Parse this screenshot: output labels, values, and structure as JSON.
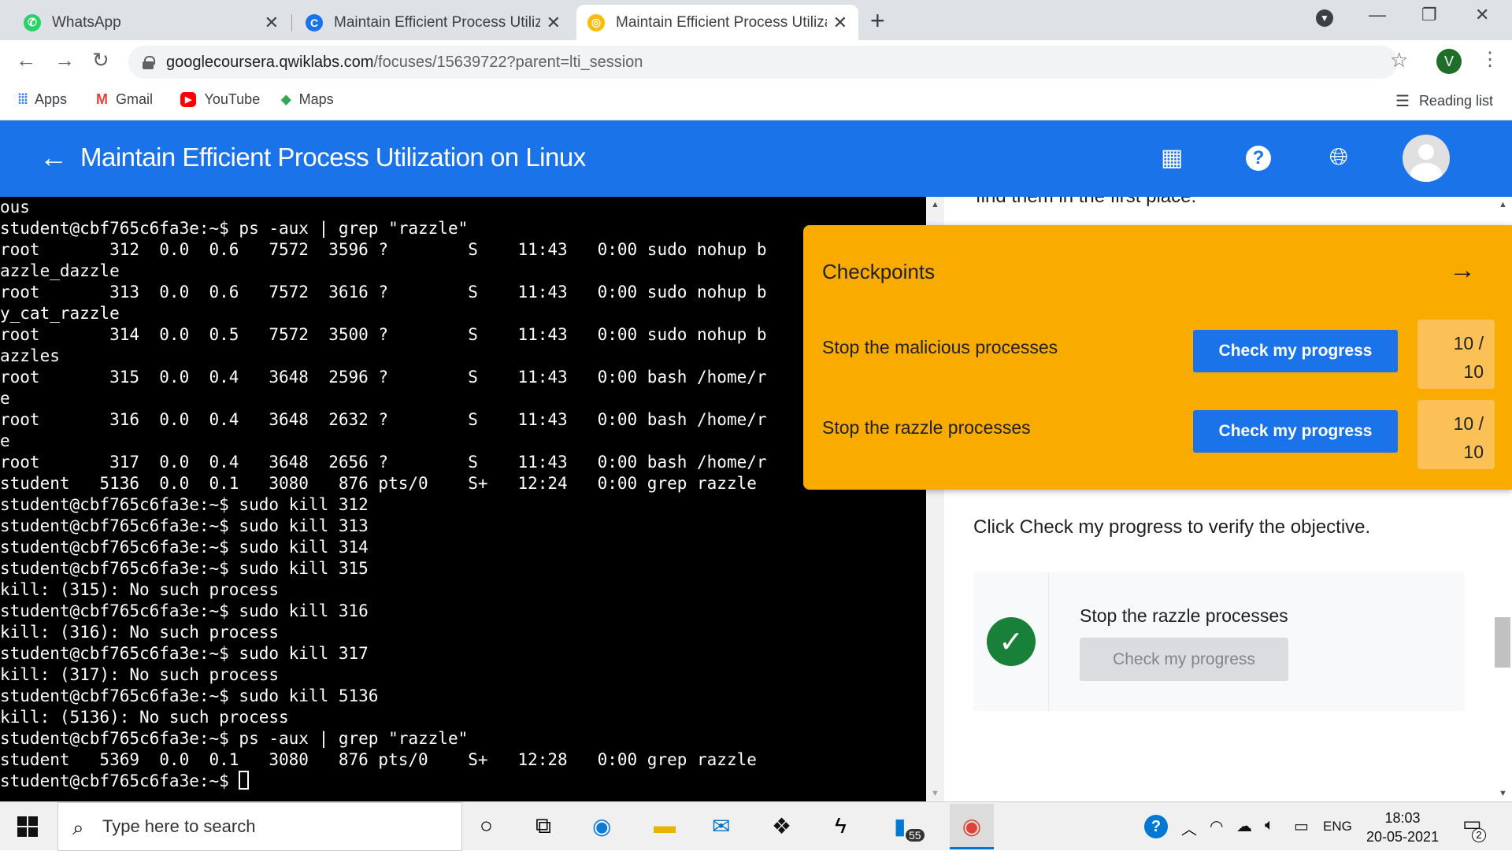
{
  "browser": {
    "tabs": [
      {
        "title": "WhatsApp",
        "favicon_color": "#25d366"
      },
      {
        "title": "Maintain Efficient Process Utilizat",
        "favicon_color": "#1a73e8"
      },
      {
        "title": "Maintain Efficient Process Utilizat",
        "favicon_color": "#fbbc04",
        "active": true
      }
    ],
    "new_tab_icon": "plus-icon",
    "url_host": "googlecoursera.qwiklabs.com",
    "url_path": "/focuses/15639722?parent=lti_session",
    "profile_initial": "V",
    "bookmarks": [
      {
        "label": "Apps",
        "icon": "apps-grid-icon"
      },
      {
        "label": "Gmail",
        "icon": "gmail-icon"
      },
      {
        "label": "YouTube",
        "icon": "youtube-icon"
      },
      {
        "label": "Maps",
        "icon": "maps-icon"
      }
    ],
    "reading_list": "Reading list"
  },
  "app": {
    "title": "Maintain Efficient Process Utilization on Linux",
    "accent": "#1a73e8"
  },
  "terminal": {
    "lines": [
      "ous",
      "student@cbf765c6fa3e:~$ ps -aux | grep \"razzle\"",
      "root       312  0.0  0.6   7572  3596 ?        S    11:43   0:00 sudo nohup b",
      "azzle_dazzle",
      "root       313  0.0  0.6   7572  3616 ?        S    11:43   0:00 sudo nohup b",
      "y_cat_razzle",
      "root       314  0.0  0.5   7572  3500 ?        S    11:43   0:00 sudo nohup b",
      "azzles",
      "root       315  0.0  0.4   3648  2596 ?        S    11:43   0:00 bash /home/r",
      "e",
      "root       316  0.0  0.4   3648  2632 ?        S    11:43   0:00 bash /home/r",
      "e",
      "root       317  0.0  0.4   3648  2656 ?        S    11:43   0:00 bash /home/r",
      "student   5136  0.0  0.1   3080   876 pts/0    S+   12:24   0:00 grep razzle",
      "student@cbf765c6fa3e:~$ sudo kill 312",
      "student@cbf765c6fa3e:~$ sudo kill 313",
      "student@cbf765c6fa3e:~$ sudo kill 314",
      "student@cbf765c6fa3e:~$ sudo kill 315",
      "kill: (315): No such process",
      "student@cbf765c6fa3e:~$ sudo kill 316",
      "kill: (316): No such process",
      "student@cbf765c6fa3e:~$ sudo kill 317",
      "kill: (317): No such process",
      "student@cbf765c6fa3e:~$ sudo kill 5136",
      "kill: (5136): No such process",
      "student@cbf765c6fa3e:~$ ps -aux | grep \"razzle\"",
      "student   5369  0.0  0.1   3080   876 pts/0    S+   12:28   0:00 grep razzle"
    ],
    "prompt": "student@cbf765c6fa3e:~$ "
  },
  "panel": {
    "cut_text": "find them in the first place.",
    "instruction": "Click Check my progress to verify the objective.",
    "task": {
      "name": "Stop the razzle processes",
      "button": "Check my progress",
      "status_icon": "checkmark-icon"
    }
  },
  "checkpoints": {
    "title": "Checkpoints",
    "bg_color": "#f9ab00",
    "items": [
      {
        "label": "Stop the malicious processes",
        "button": "Check my progress",
        "score_top": "10 /",
        "score_bottom": "10"
      },
      {
        "label": "Stop the razzle processes",
        "button": "Check my progress",
        "score_top": "10 /",
        "score_bottom": "10"
      }
    ]
  },
  "taskbar": {
    "search_placeholder": "Type here to search",
    "mail_badge": "55",
    "language": "ENG",
    "time": "18:03",
    "date": "20-05-2021",
    "notification_count": "2"
  }
}
